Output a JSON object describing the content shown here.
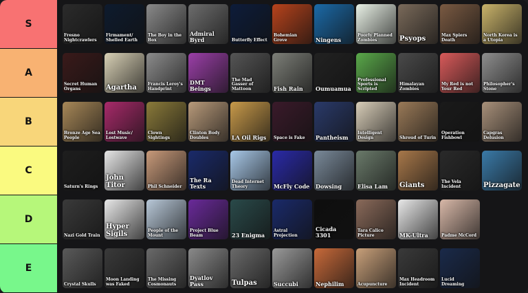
{
  "tiers": [
    {
      "label": "S",
      "color": "#f87272",
      "items": [
        {
          "caption": "Fresno Nightcrawlers",
          "bg": "#2b2b2b",
          "size": "s"
        },
        {
          "caption": "Firmament/ Shelled Earth",
          "bg": "#0e1b2e",
          "size": "s"
        },
        {
          "caption": "The Boy in the Box",
          "bg": "#8a8a8a",
          "size": "s"
        },
        {
          "caption": "Admiral Byrd",
          "bg": "#6d6d6d",
          "size": "m"
        },
        {
          "caption": "Butterfly Effect",
          "bg": "#0d1c3a",
          "size": "s"
        },
        {
          "caption": "Bohemian Grove",
          "bg": "#b7431c",
          "size": "s"
        },
        {
          "caption": "Ningens",
          "bg": "#1b6aa8",
          "size": "m"
        },
        {
          "caption": "Poorly Planned Zombies",
          "bg": "#e9f1e6",
          "size": "s"
        },
        {
          "caption": "Psyops",
          "bg": "#7a6a5a",
          "size": "l"
        },
        {
          "caption": "Max Spiers Death",
          "bg": "#7a5a42",
          "size": "s"
        },
        {
          "caption": "North Korea is a Utopia",
          "bg": "#c9b36a",
          "size": "s"
        }
      ]
    },
    {
      "label": "A",
      "color": "#f8b272",
      "items": [
        {
          "caption": "Secret Human Organs",
          "bg": "#3a1a1a",
          "size": "s"
        },
        {
          "caption": "Agartha",
          "bg": "#d8d0b5",
          "size": "l"
        },
        {
          "caption": "Francis Leroy's Handprint",
          "bg": "#8c8c8c",
          "size": "s"
        },
        {
          "caption": "DMT Beings",
          "bg": "#9b3fa8",
          "size": "m"
        },
        {
          "caption": "The Mad Gasser of Mattoon",
          "bg": "#555555",
          "size": "s"
        },
        {
          "caption": "Fish Rain",
          "bg": "#7d7f78",
          "size": "m"
        },
        {
          "caption": "Oumuamua",
          "bg": "#222222",
          "size": "m"
        },
        {
          "caption": "Professional Sports is Scripted",
          "bg": "#5aa84a",
          "size": "s"
        },
        {
          "caption": "Himalayan Zombies",
          "bg": "#4a4a4a",
          "size": "s"
        },
        {
          "caption": "My Red is not Your Red",
          "bg": "#d85a5a",
          "size": "s"
        },
        {
          "caption": "Philosopher's Stone",
          "bg": "#8e8e8e",
          "size": "s"
        }
      ]
    },
    {
      "label": "B",
      "color": "#f8d67a",
      "items": [
        {
          "caption": "Bronze Age Sea People",
          "bg": "#a88858",
          "size": "s"
        },
        {
          "caption": "Lost Music/ Lostwave",
          "bg": "#a82a6a",
          "size": "s"
        },
        {
          "caption": "Clown Sightings",
          "bg": "#8a7a3a",
          "size": "s"
        },
        {
          "caption": "Clinton Body Doubles",
          "bg": "#b89a7a",
          "size": "s"
        },
        {
          "caption": "LA Oil Rigs",
          "bg": "#c89a4a",
          "size": "m"
        },
        {
          "caption": "Space is Fake",
          "bg": "#3a1a2a",
          "size": "s"
        },
        {
          "caption": "Pantheism",
          "bg": "#2a3a6a",
          "size": "m"
        },
        {
          "caption": "Intelligent Design",
          "bg": "#d8cdb8",
          "size": "s"
        },
        {
          "caption": "Shroud of Turin",
          "bg": "#9a7a58",
          "size": "s"
        },
        {
          "caption": "Operation Fishbowl",
          "bg": "#1a1a1a",
          "size": "s"
        },
        {
          "caption": "Capgras Delusion",
          "bg": "#a8907a",
          "size": "s"
        }
      ]
    },
    {
      "label": "C",
      "color": "#fafa80",
      "items": [
        {
          "caption": "Saturn's Rings",
          "bg": "#1e1e1e",
          "size": "s"
        },
        {
          "caption": "John Titor",
          "bg": "#e6e6e6",
          "size": "l"
        },
        {
          "caption": "Phil Schneider",
          "bg": "#c89a7a",
          "size": "s"
        },
        {
          "caption": "The Ra Texts",
          "bg": "#1a2a6a",
          "size": "m"
        },
        {
          "caption": "Dead Internet Theory",
          "bg": "#a8c8e8",
          "size": "s"
        },
        {
          "caption": "McFly Code",
          "bg": "#2a2aa8",
          "size": "m"
        },
        {
          "caption": "Dowsing",
          "bg": "#7a8a9a",
          "size": "m"
        },
        {
          "caption": "Elisa Lam",
          "bg": "#6a7a6a",
          "size": "m"
        },
        {
          "caption": "Giants",
          "bg": "#a8784a",
          "size": "l"
        },
        {
          "caption": "The Vela Incident",
          "bg": "#2a2a2a",
          "size": "s"
        },
        {
          "caption": "Pizzagate",
          "bg": "#3a7aa8",
          "size": "l"
        }
      ]
    },
    {
      "label": "D",
      "color": "#b6f77a",
      "items": [
        {
          "caption": "Nazi Gold Train",
          "bg": "#3a3a3a",
          "size": "s"
        },
        {
          "caption": "Hyper Sigils",
          "bg": "#e8e8e8",
          "size": "l"
        },
        {
          "caption": "People of the Mount",
          "bg": "#b8c8d8",
          "size": "s"
        },
        {
          "caption": "Project Blue Beam",
          "bg": "#6a2a9a",
          "size": "s"
        },
        {
          "caption": "23 Enigma",
          "bg": "#2a4a4a",
          "size": "m"
        },
        {
          "caption": "Astral Projection",
          "bg": "#1a2a6a",
          "size": "s"
        },
        {
          "caption": "Cicada 3301",
          "bg": "#0e0e0e",
          "size": "m"
        },
        {
          "caption": "Tara Calico Picture",
          "bg": "#8a6a5a",
          "size": "s"
        },
        {
          "caption": "MK-Ultra",
          "bg": "#e8e8e8",
          "size": "m"
        },
        {
          "caption": "Padme McCord",
          "bg": "#d8b8a8",
          "size": "s"
        }
      ]
    },
    {
      "label": "E",
      "color": "#78f78b",
      "items": [
        {
          "caption": "Crystal Skulls",
          "bg": "#5a5a5a",
          "size": "s"
        },
        {
          "caption": "Moon Landing was Faked",
          "bg": "#3a3a3a",
          "size": "s"
        },
        {
          "caption": "The Missing Cosmonauts",
          "bg": "#6a6a6a",
          "size": "s"
        },
        {
          "caption": "Dyatlov Pass",
          "bg": "#8a8a8a",
          "size": "m"
        },
        {
          "caption": "Tulpas",
          "bg": "#6a6a6a",
          "size": "l"
        },
        {
          "caption": "Succubi",
          "bg": "#9a9a9a",
          "size": "m"
        },
        {
          "caption": "Nephilim",
          "bg": "#c86a3a",
          "size": "m"
        },
        {
          "caption": "Acupuncture",
          "bg": "#c8a07a",
          "size": "s"
        },
        {
          "caption": "Max Headroom Incident",
          "bg": "#3a3a3a",
          "size": "s"
        },
        {
          "caption": "Lucid Dreaming",
          "bg": "#1a2a4a",
          "size": "s"
        }
      ]
    }
  ]
}
